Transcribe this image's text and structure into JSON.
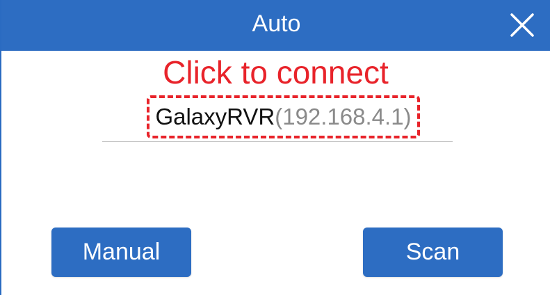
{
  "dialog": {
    "title": "Auto",
    "close_icon": "close-icon"
  },
  "hint": {
    "text": "Click to connect"
  },
  "device": {
    "name": "GalaxyRVR",
    "ip": "(192.168.4.1)"
  },
  "buttons": {
    "manual_label": "Manual",
    "scan_label": "Scan"
  },
  "colors": {
    "accent": "#2d6dc2",
    "highlight": "#e8232a",
    "muted_text": "#8a8a8a"
  }
}
